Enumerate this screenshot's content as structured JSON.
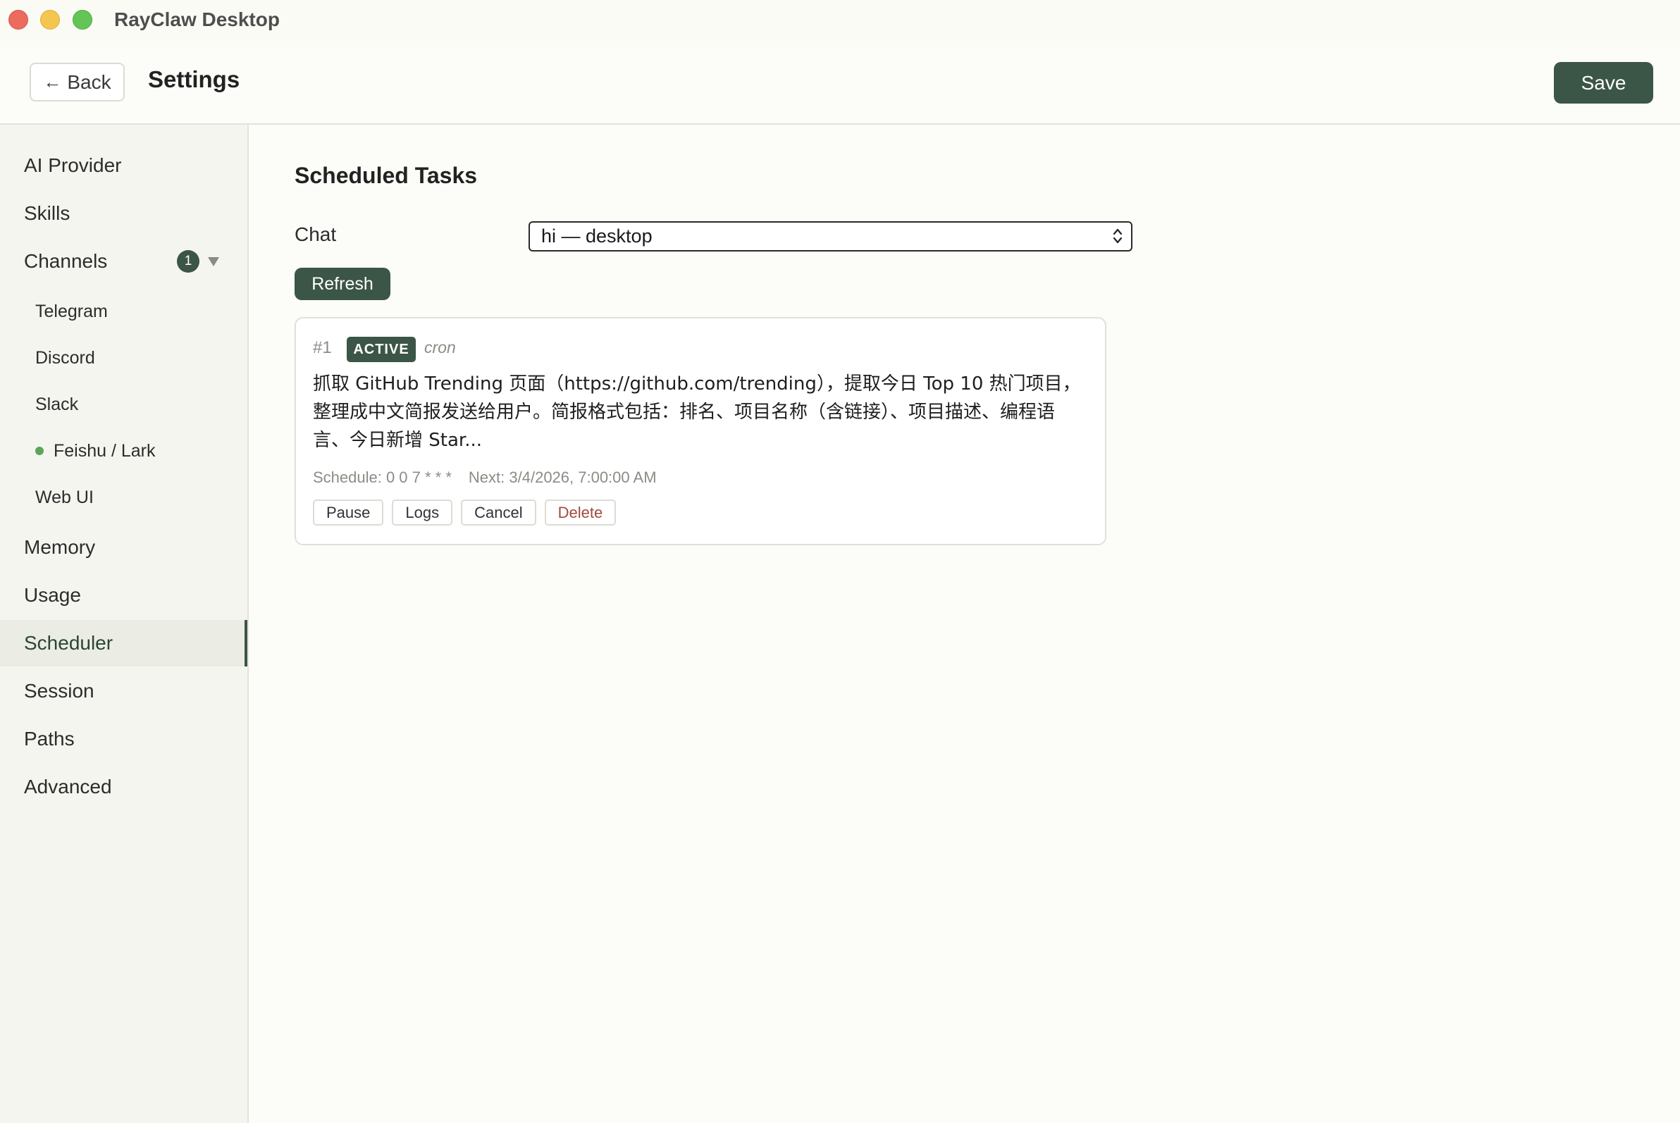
{
  "window": {
    "title": "RayClaw Desktop"
  },
  "header": {
    "back_label": "Back",
    "title": "Settings",
    "save_label": "Save"
  },
  "sidebar": {
    "items": [
      {
        "label": "AI Provider"
      },
      {
        "label": "Skills"
      },
      {
        "label": "Channels",
        "badge": "1"
      },
      {
        "label": "Telegram"
      },
      {
        "label": "Discord"
      },
      {
        "label": "Slack"
      },
      {
        "label": "Feishu / Lark"
      },
      {
        "label": "Web UI"
      },
      {
        "label": "Memory"
      },
      {
        "label": "Usage"
      },
      {
        "label": "Scheduler"
      },
      {
        "label": "Session"
      },
      {
        "label": "Paths"
      },
      {
        "label": "Advanced"
      }
    ],
    "active": "Scheduler",
    "connected_channel": "Feishu / Lark"
  },
  "main": {
    "section_title": "Scheduled Tasks",
    "chat_label": "Chat",
    "chat_selected": "hi — desktop",
    "refresh_label": "Refresh",
    "task": {
      "id": "#1",
      "status": "ACTIVE",
      "type": "cron",
      "prompt": "抓取 GitHub Trending 页面（https://github.com/trending），提取今日 Top 10 热门项目，整理成中文简报发送给用户。简报格式包括：排名、项目名称（含链接）、项目描述、编程语言、今日新增 Star...",
      "schedule": "Schedule: 0 0 7 * * *",
      "next": "Next: 3/4/2026, 7:00:00 AM",
      "actions": {
        "pause": "Pause",
        "logs": "Logs",
        "cancel": "Cancel",
        "delete": "Delete"
      }
    }
  },
  "colors": {
    "accent": "#3b5546",
    "danger": "#a04b3c",
    "online": "#5aa55a"
  }
}
